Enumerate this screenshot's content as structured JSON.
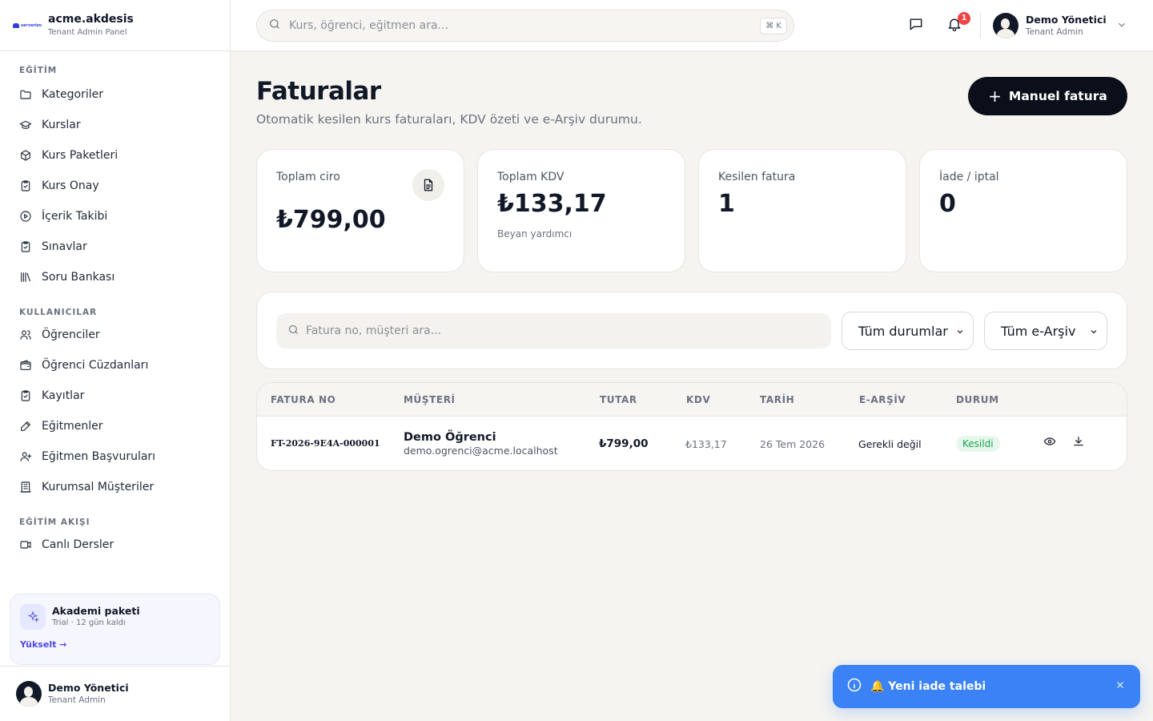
{
  "brand": {
    "logo_text": "serverizo",
    "title": "acme.akdesis",
    "subtitle": "Tenant Admin Panel"
  },
  "sidebar": {
    "sections": [
      {
        "title": "EĞİTİM",
        "items": [
          {
            "label": "Kategoriler",
            "icon": "folder-icon"
          },
          {
            "label": "Kurslar",
            "icon": "graduation-cap-icon"
          },
          {
            "label": "Kurs Paketleri",
            "icon": "package-icon"
          },
          {
            "label": "Kurs Onay",
            "icon": "clipboard-check-icon"
          },
          {
            "label": "İçerik Takibi",
            "icon": "play-circle-icon"
          },
          {
            "label": "Sınavlar",
            "icon": "clipboard-check-icon"
          },
          {
            "label": "Soru Bankası",
            "icon": "library-icon"
          }
        ]
      },
      {
        "title": "KULLANICILAR",
        "items": [
          {
            "label": "Öğrenciler",
            "icon": "users-icon"
          },
          {
            "label": "Öğrenci Cüzdanları",
            "icon": "wallet-icon"
          },
          {
            "label": "Kayıtlar",
            "icon": "clipboard-check-icon"
          },
          {
            "label": "Eğitmenler",
            "icon": "pencil-icon"
          },
          {
            "label": "Eğitmen Başvuruları",
            "icon": "user-plus-icon"
          },
          {
            "label": "Kurumsal Müşteriler",
            "icon": "building-icon"
          }
        ]
      },
      {
        "title": "EĞİTİM AKIŞI",
        "items": [
          {
            "label": "Canlı Dersler",
            "icon": "video-icon"
          }
        ]
      }
    ],
    "plan": {
      "title": "Akademi paketi",
      "subtitle": "Trial · 12 gün kaldı",
      "link": "Yükselt →"
    },
    "user": {
      "name": "Demo Yönetici",
      "role": "Tenant Admin"
    }
  },
  "topbar": {
    "search_placeholder": "Kurs, öğrenci, eğitmen ara...",
    "shortcut": "⌘ K",
    "notification_count": "1",
    "user": {
      "name": "Demo Yönetici",
      "role": "Tenant Admin"
    }
  },
  "page": {
    "title": "Faturalar",
    "subtitle": "Otomatik kesilen kurs faturaları, KDV özeti ve e-Arşiv durumu.",
    "primary_button": "Manuel fatura"
  },
  "stats": [
    {
      "label": "Toplam ciro",
      "value": "₺799,00",
      "note": "",
      "icon": "file-text-icon"
    },
    {
      "label": "Toplam KDV",
      "value": "₺133,17",
      "note": "Beyan yardımcı"
    },
    {
      "label": "Kesilen fatura",
      "value": "1",
      "note": ""
    },
    {
      "label": "İade / iptal",
      "value": "0",
      "note": ""
    }
  ],
  "filters": {
    "search_placeholder": "Fatura no, müşteri ara...",
    "status_select": "Tüm durumlar",
    "earchive_select": "Tüm e-Arşiv"
  },
  "table": {
    "columns": [
      "FATURA NO",
      "MÜŞTERİ",
      "TUTAR",
      "KDV",
      "TARİH",
      "E-ARŞİV",
      "DURUM"
    ],
    "rows": [
      {
        "invoice_no": "FT-2026-9E4A-000001",
        "customer_name": "Demo Öğrenci",
        "customer_email": "demo.ogrenci@acme.localhost",
        "amount": "₺799,00",
        "vat": "₺133,17",
        "date": "26 Tem 2026",
        "earchive": "Gerekli değil",
        "status": "Kesildi"
      }
    ]
  },
  "toast": {
    "message": "🔔 Yeni iade talebi"
  },
  "colors": {
    "accent": "#0b0f19",
    "toast": "#3b82f6",
    "status_success": "#16a34a",
    "badge": "#ef4444"
  }
}
